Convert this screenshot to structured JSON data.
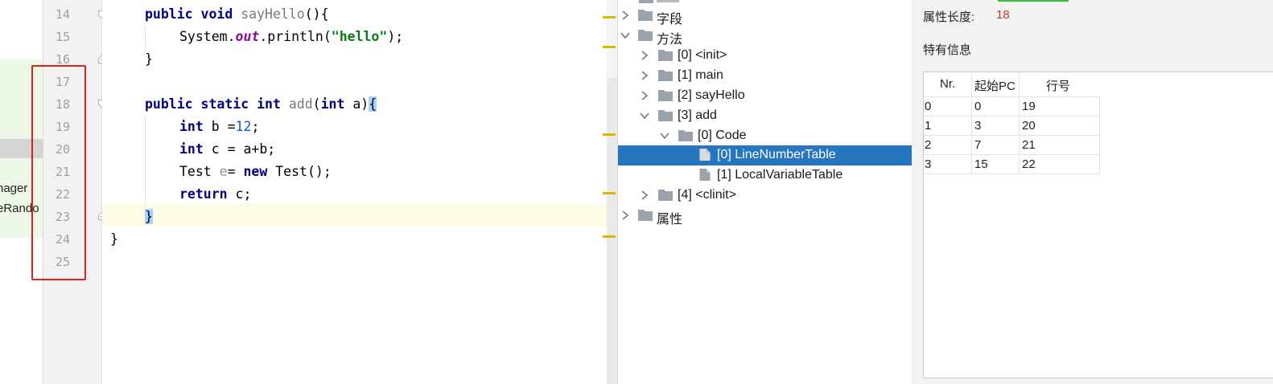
{
  "project_panel": {
    "partial_items": [
      "nager",
      "eRando"
    ]
  },
  "editor": {
    "line_numbers": [
      "14",
      "15",
      "16",
      "17",
      "18",
      "19",
      "20",
      "21",
      "22",
      "23",
      "24",
      "25"
    ],
    "code": {
      "l14_kw": "public void",
      "l14_name": "sayHello",
      "l14_rest": "(){",
      "l15_a": "System.",
      "l15_out": "out",
      "l15_b": ".println(",
      "l15_str": "\"hello\"",
      "l15_c": ");",
      "l16": "}",
      "l18_kw1": "public static int",
      "l18_name": "add",
      "l18_a": "(",
      "l18_kw2": "int",
      "l18_b": " a)",
      "l18_brace": "{",
      "l19_kw": "int",
      "l19_a": " b =",
      "l19_num": "12",
      "l19_b": ";",
      "l20_kw": "int",
      "l20_a": " c = a+b;",
      "l21_a": "Test ",
      "l21_e": "e",
      "l21_b": "= ",
      "l21_kw": "new",
      "l21_c": " Test();",
      "l22_kw": "return",
      "l22_a": " c;",
      "l23_brace": "}",
      "l24": "}"
    }
  },
  "tree": {
    "items": [
      {
        "label": "字段",
        "expanded": false
      },
      {
        "label": "方法",
        "expanded": true
      },
      {
        "label": "[0] <init>",
        "expanded": false
      },
      {
        "label": "[1] main",
        "expanded": false
      },
      {
        "label": "[2] sayHello",
        "expanded": false
      },
      {
        "label": "[3] add",
        "expanded": true
      },
      {
        "label": "[0] Code",
        "expanded": true
      },
      {
        "label": "[0] LineNumberTable",
        "selected": true
      },
      {
        "label": "[1] LocalVariableTable"
      },
      {
        "label": "[4] <clinit>",
        "expanded": false
      },
      {
        "label": "属性",
        "expanded": false
      }
    ],
    "selected_color": "#2675bf"
  },
  "info": {
    "attr_length_label": "属性长度:",
    "attr_length_value": "18",
    "special_info_label": "特有信息",
    "table": {
      "headers": [
        "Nr.",
        "起始PC",
        "行号"
      ],
      "rows": [
        [
          "0",
          "0",
          "19"
        ],
        [
          "1",
          "3",
          "20"
        ],
        [
          "2",
          "7",
          "21"
        ],
        [
          "3",
          "15",
          "22"
        ]
      ]
    }
  },
  "colors": {
    "keyword": "#000080",
    "string": "#067d17",
    "number": "#1750eb",
    "field": "#871094",
    "highlight_box": "#e02020",
    "value_red": "#c0392b"
  }
}
